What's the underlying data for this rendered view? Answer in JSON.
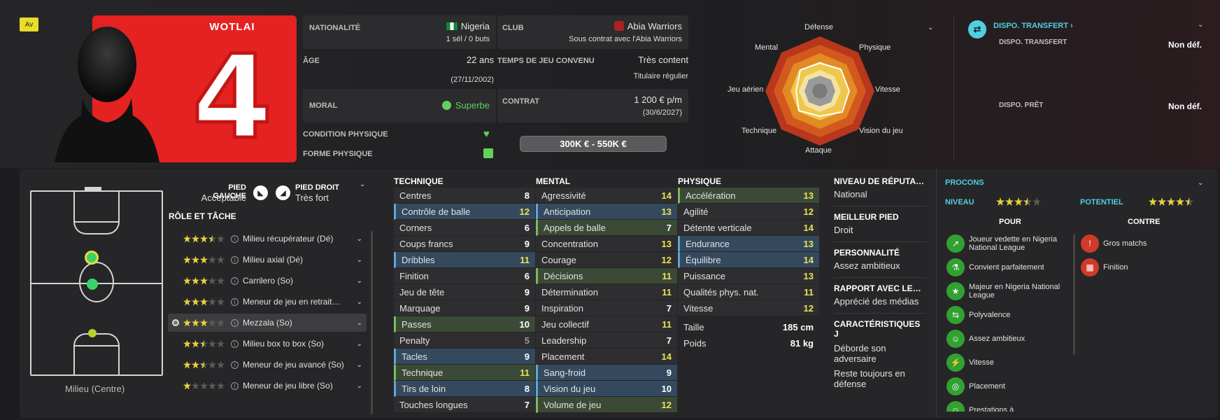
{
  "player": {
    "position_badge": "Av",
    "shirt_name": "WOTLAI",
    "shirt_number": "4"
  },
  "details": {
    "nationality_label": "NATIONALITÉ",
    "nationality": "Nigeria",
    "caps": "1 sél / 0 buts",
    "club_label": "CLUB",
    "club": "Abia Warriors",
    "contract_status": "Sous contrat avec l'Abia Warriors",
    "age_label": "ÂGE",
    "age": "22 ans",
    "birthdate": "(27/11/2002)",
    "playing_time_label": "TEMPS DE JEU CONVENU",
    "playing_time_status": "Très content",
    "playing_time": "Titulaire régulier",
    "morale_label": "MORAL",
    "morale": "Superbe",
    "contract_label": "CONTRAT",
    "wage": "1 200 € p/m",
    "contract_end": "(30/6/2027)",
    "condition_label": "CONDITION PHYSIQUE",
    "form_label": "FORME PHYSIQUE",
    "value_range": "300K € - 550K €"
  },
  "radar": {
    "labels": [
      "Défense",
      "Physique",
      "Vitesse",
      "Vision du jeu",
      "Attaque",
      "Technique",
      "Jeu aérien",
      "Mental"
    ]
  },
  "transfer": {
    "header": "DISPO. TRANSFERT",
    "transfer_label": "DISPO. TRANSFERT",
    "transfer_value": "Non déf.",
    "loan_label": "DISPO. PRÊT",
    "loan_value": "Non déf."
  },
  "feet": {
    "left_label": "PIED GAUCHE",
    "left_value": "Acceptable",
    "right_label": "PIED DROIT",
    "right_value": "Très fort"
  },
  "roles": {
    "title": "RÔLE ET TÂCHE",
    "position": "Milieu (Centre)",
    "items": [
      {
        "name": "Milieu récupérateur (Dé)",
        "stars": 3.5
      },
      {
        "name": "Milieu axial (Dé)",
        "stars": 3
      },
      {
        "name": "Carrilero (So)",
        "stars": 3
      },
      {
        "name": "Meneur de jeu en retrait…",
        "stars": 3
      },
      {
        "name": "Mezzala (So)",
        "stars": 3
      },
      {
        "name": "Milieu box to box (So)",
        "stars": 2.5
      },
      {
        "name": "Meneur de jeu avancé (So)",
        "stars": 2.5
      },
      {
        "name": "Meneur de jeu libre (So)",
        "stars": 1
      }
    ]
  },
  "attributes": {
    "technique_title": "TECHNIQUE",
    "mental_title": "MENTAL",
    "physique_title": "PHYSIQUE",
    "technique": [
      {
        "n": "Centres",
        "v": "8",
        "h": ""
      },
      {
        "n": "Contrôle de balle",
        "v": "12",
        "h": "b"
      },
      {
        "n": "Corners",
        "v": "6",
        "h": ""
      },
      {
        "n": "Coups francs",
        "v": "9",
        "h": ""
      },
      {
        "n": "Dribbles",
        "v": "11",
        "h": "b"
      },
      {
        "n": "Finition",
        "v": "6",
        "h": ""
      },
      {
        "n": "Jeu de tête",
        "v": "9",
        "h": ""
      },
      {
        "n": "Marquage",
        "v": "9",
        "h": ""
      },
      {
        "n": "Passes",
        "v": "10",
        "h": "g"
      },
      {
        "n": "Penalty",
        "v": "5",
        "h": ""
      },
      {
        "n": "Tacles",
        "v": "9",
        "h": "b"
      },
      {
        "n": "Technique",
        "v": "11",
        "h": "g"
      },
      {
        "n": "Tirs de loin",
        "v": "8",
        "h": "b"
      },
      {
        "n": "Touches longues",
        "v": "7",
        "h": ""
      }
    ],
    "mental": [
      {
        "n": "Agressivité",
        "v": "14",
        "h": ""
      },
      {
        "n": "Anticipation",
        "v": "13",
        "h": "b"
      },
      {
        "n": "Appels de balle",
        "v": "7",
        "h": "g"
      },
      {
        "n": "Concentration",
        "v": "13",
        "h": ""
      },
      {
        "n": "Courage",
        "v": "12",
        "h": ""
      },
      {
        "n": "Décisions",
        "v": "11",
        "h": "g"
      },
      {
        "n": "Détermination",
        "v": "11",
        "h": ""
      },
      {
        "n": "Inspiration",
        "v": "7",
        "h": ""
      },
      {
        "n": "Jeu collectif",
        "v": "11",
        "h": ""
      },
      {
        "n": "Leadership",
        "v": "7",
        "h": ""
      },
      {
        "n": "Placement",
        "v": "14",
        "h": ""
      },
      {
        "n": "Sang-froid",
        "v": "9",
        "h": "b"
      },
      {
        "n": "Vision du jeu",
        "v": "10",
        "h": "b"
      },
      {
        "n": "Volume de jeu",
        "v": "12",
        "h": "g"
      }
    ],
    "physique": [
      {
        "n": "Accélération",
        "v": "13",
        "h": "g"
      },
      {
        "n": "Agilité",
        "v": "12",
        "h": ""
      },
      {
        "n": "Détente verticale",
        "v": "14",
        "h": ""
      },
      {
        "n": "Endurance",
        "v": "13",
        "h": "b"
      },
      {
        "n": "Équilibre",
        "v": "14",
        "h": "b"
      },
      {
        "n": "Puissance",
        "v": "13",
        "h": ""
      },
      {
        "n": "Qualités phys. nat.",
        "v": "11",
        "h": ""
      },
      {
        "n": "Vitesse",
        "v": "12",
        "h": ""
      }
    ],
    "height_label": "Taille",
    "height": "185 cm",
    "weight_label": "Poids",
    "weight": "81 kg"
  },
  "info": {
    "reputation_label": "NIVEAU DE RÉPUTA…",
    "reputation": "National",
    "best_foot_label": "MEILLEUR PIED",
    "best_foot": "Droit",
    "personality_label": "PERSONNALITÉ",
    "personality": "Assez ambitieux",
    "media_label": "RAPPORT AVEC LE…",
    "media": "Apprécié des médias",
    "traits_label": "CARACTÉRISTIQUES J",
    "trait1": "Déborde son adversaire",
    "trait2": "Reste toujours en défense"
  },
  "procons": {
    "title": "PROCONS",
    "level_label": "NIVEAU",
    "level_stars": 3.5,
    "potential_label": "POTENTIEL",
    "potential_stars": 4.5,
    "pros_title": "POUR",
    "cons_title": "CONTRE",
    "pros": [
      "Joueur vedette en Nigeria National League",
      "Convient parfaitement",
      "Majeur en Nigeria National League",
      "Polyvalence",
      "Assez ambitieux",
      "Vitesse",
      "Placement",
      "Prestations à"
    ],
    "cons": [
      "Gros matchs",
      "Finition"
    ]
  },
  "colors": {
    "accent": "#4fd0e0",
    "highlight_yellow": "#e9e25a",
    "shirt_red": "#e52222"
  }
}
